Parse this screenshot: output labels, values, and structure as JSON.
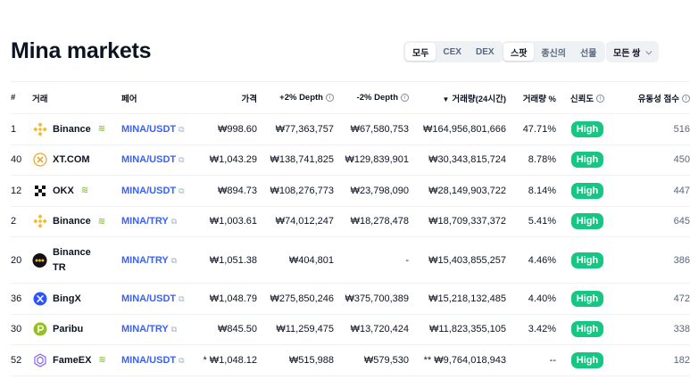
{
  "page": {
    "title": "Mina markets"
  },
  "filters": {
    "group1": [
      "모두",
      "CEX",
      "DEX"
    ],
    "group2": [
      "스팟",
      "종신의",
      "선물"
    ],
    "pair_dropdown": "모든 쌍"
  },
  "table": {
    "headers": {
      "rank": "#",
      "exchange": "거래",
      "pair": "페어",
      "price": "가격",
      "depth_plus": "+2% Depth",
      "depth_minus": "-2% Depth",
      "volume": "거래량(24시간)",
      "volume_pct": "거래량 %",
      "confidence": "신뢰도",
      "liquidity": "유동성 점수"
    },
    "rows": [
      {
        "rank": "1",
        "exchange": "Binance",
        "logo": "binance-logo",
        "verified": true,
        "pair": "MINA/USDT",
        "price": "₩998.60",
        "depth_plus": "₩77,363,757",
        "depth_minus": "₩67,580,753",
        "volume": "₩164,956,801,666",
        "volume_pct": "47.71%",
        "confidence": "High",
        "liquidity": "516"
      },
      {
        "rank": "40",
        "exchange": "XT.COM",
        "logo": "xtcom-logo",
        "verified": false,
        "pair": "MINA/USDT",
        "price": "₩1,043.29",
        "depth_plus": "₩138,741,825",
        "depth_minus": "₩129,839,901",
        "volume": "₩30,343,815,724",
        "volume_pct": "8.78%",
        "confidence": "High",
        "liquidity": "450"
      },
      {
        "rank": "12",
        "exchange": "OKX",
        "logo": "okx-logo",
        "verified": true,
        "pair": "MINA/USDT",
        "price": "₩894.73",
        "depth_plus": "₩108,276,773",
        "depth_minus": "₩23,798,090",
        "volume": "₩28,149,903,722",
        "volume_pct": "8.14%",
        "confidence": "High",
        "liquidity": "447"
      },
      {
        "rank": "2",
        "exchange": "Binance",
        "logo": "binance-logo",
        "verified": true,
        "pair": "MINA/TRY",
        "price": "₩1,003.61",
        "depth_plus": "₩74,012,247",
        "depth_minus": "₩18,278,478",
        "volume": "₩18,709,337,372",
        "volume_pct": "5.41%",
        "confidence": "High",
        "liquidity": "645"
      },
      {
        "rank": "20",
        "exchange": "Binance TR",
        "logo": "binancetr-logo",
        "verified": false,
        "pair": "MINA/TRY",
        "price": "₩1,051.38",
        "depth_plus": "₩404,801",
        "depth_minus": "-",
        "volume": "₩15,403,855,257",
        "volume_pct": "4.46%",
        "confidence": "High",
        "liquidity": "386"
      },
      {
        "rank": "36",
        "exchange": "BingX",
        "logo": "bingx-logo",
        "verified": false,
        "pair": "MINA/USDT",
        "price": "₩1,048.79",
        "depth_plus": "₩275,850,246",
        "depth_minus": "₩375,700,389",
        "volume": "₩15,218,132,485",
        "volume_pct": "4.40%",
        "confidence": "High",
        "liquidity": "472"
      },
      {
        "rank": "30",
        "exchange": "Paribu",
        "logo": "paribu-logo",
        "verified": false,
        "pair": "MINA/TRY",
        "price": "₩845.50",
        "depth_plus": "₩11,259,475",
        "depth_minus": "₩13,720,424",
        "volume": "₩11,823,355,105",
        "volume_pct": "3.42%",
        "confidence": "High",
        "liquidity": "338"
      },
      {
        "rank": "52",
        "exchange": "FameEX",
        "logo": "fameex-logo",
        "verified": true,
        "pair": "MINA/USDT",
        "price": "* ₩1,048.12",
        "depth_plus": "₩515,988",
        "depth_minus": "₩579,530",
        "volume": "** ₩9,764,018,943",
        "volume_pct": "--",
        "confidence": "High",
        "liquidity": "182"
      }
    ]
  },
  "colors": {
    "link": "#3861fb",
    "high_badge": "#16c784",
    "verified": "#8dc647"
  }
}
